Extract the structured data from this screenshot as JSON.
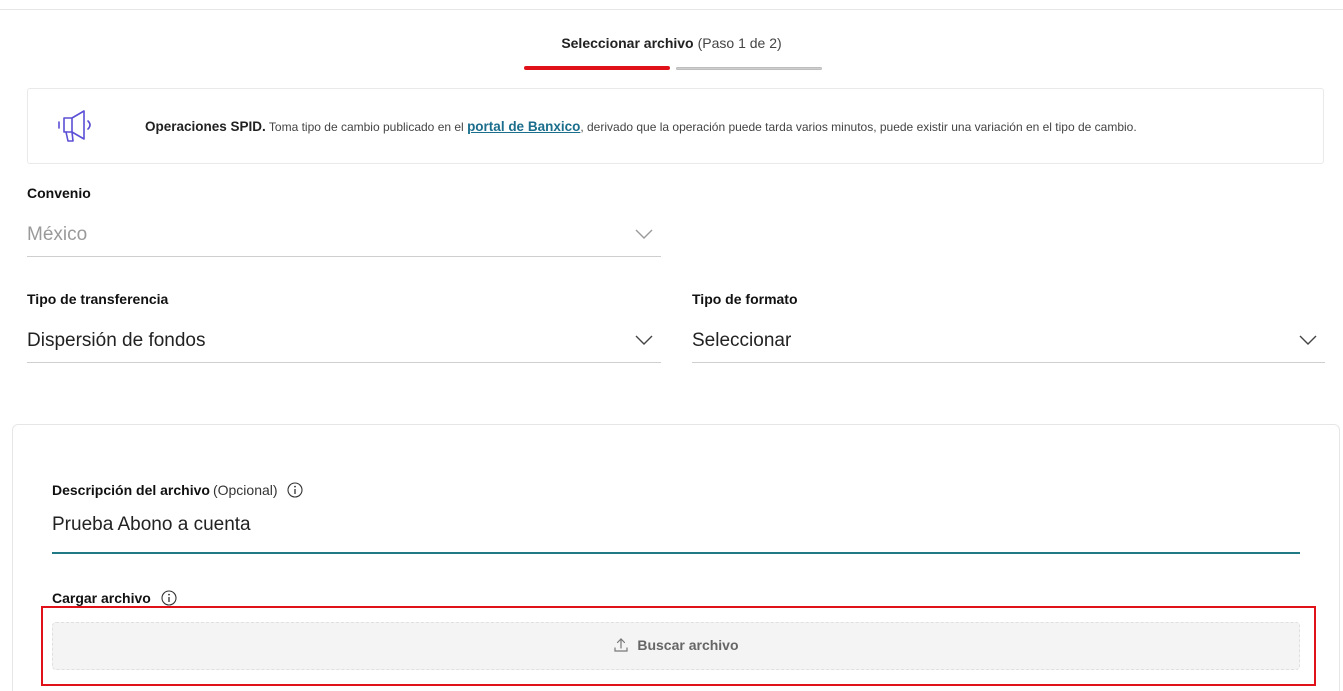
{
  "stepper": {
    "title": "Seleccionar archivo",
    "step_text": "(Paso 1 de 2)",
    "progress_fraction": 0.5,
    "accent_color": "#e1111a"
  },
  "notice": {
    "icon": "megaphone-icon",
    "title": "Operaciones SPID.",
    "text_before_link": "Toma tipo de cambio publicado en el",
    "link_text": "portal de Banxico",
    "text_after_link": ", derivado que la operación puede tarda varios minutos, puede existir una variación en el tipo de cambio."
  },
  "convenio": {
    "label": "Convenio",
    "value": "México"
  },
  "tipo_transferencia": {
    "label": "Tipo de transferencia",
    "value": "Dispersión de fondos"
  },
  "tipo_formato": {
    "label": "Tipo de formato",
    "value": "Seleccionar"
  },
  "descripcion": {
    "label": "Descripción del archivo",
    "optional": "(Opcional)",
    "value": "Prueba Abono a cuenta"
  },
  "cargar": {
    "label": "Cargar archivo",
    "button_label": "Buscar archivo",
    "icon": "upload-icon"
  }
}
